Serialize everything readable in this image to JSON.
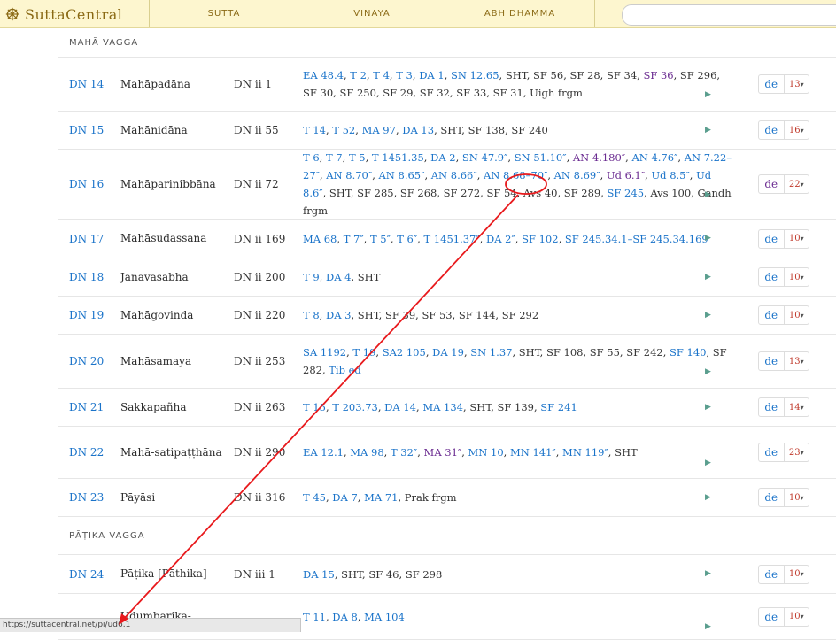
{
  "header": {
    "logo_text": "SuttaCentral",
    "nav": [
      "SUTTA",
      "VINAYA",
      "ABHIDHAMMA"
    ],
    "search_placeholder": ""
  },
  "groups": {
    "g1": "MAHĀ VAGGA",
    "g2": "PĀṬIKA VAGGA"
  },
  "rows": [
    {
      "id": "DN 14",
      "title": "Mahāpadāna",
      "vol": "DN ii 1",
      "parallels": [
        [
          "EA 48.4",
          "link"
        ],
        [
          "T 2",
          "link"
        ],
        [
          "T 4",
          "link"
        ],
        [
          "T 3",
          "link"
        ],
        [
          "DA 1",
          "link"
        ],
        [
          "SN 12.65",
          "link"
        ],
        [
          "SHT",
          ""
        ],
        [
          "SF 56",
          ""
        ],
        [
          "SF 28",
          ""
        ],
        [
          "SF 34",
          ""
        ],
        [
          "SF 36",
          "visited"
        ],
        [
          "SF 296",
          ""
        ],
        [
          "SF 30",
          ""
        ],
        [
          "SF 250",
          ""
        ],
        [
          "SF 29",
          ""
        ],
        [
          "SF 32",
          ""
        ],
        [
          "SF 33",
          ""
        ],
        [
          "SF 31",
          ""
        ],
        [
          "Uigh frgm",
          ""
        ]
      ],
      "lang": "de",
      "count": "13"
    },
    {
      "id": "DN 15",
      "title": "Mahānidāna",
      "vol": "DN ii 55",
      "parallels": [
        [
          "T 14",
          "link"
        ],
        [
          "T 52",
          "link"
        ],
        [
          "MA 97",
          "link"
        ],
        [
          "DA 13",
          "link"
        ],
        [
          "SHT",
          ""
        ],
        [
          "SF 138",
          ""
        ],
        [
          "SF 240",
          ""
        ]
      ],
      "lang": "de",
      "count": "16"
    },
    {
      "id": "DN 16",
      "title": "Mahāparinibbāna",
      "vol": "DN ii 72",
      "parallels": [
        [
          "T 6",
          "link"
        ],
        [
          "T 7",
          "link"
        ],
        [
          "T 5",
          "link"
        ],
        [
          "T 1451.35",
          "link"
        ],
        [
          "DA 2",
          "link"
        ],
        [
          "SN 47.9″",
          "link"
        ],
        [
          "SN 51.10″",
          "link"
        ],
        [
          "AN 4.180″",
          "visited"
        ],
        [
          "AN 4.76″",
          "link"
        ],
        [
          "AN 7.22–27″",
          "link"
        ],
        [
          "AN 8.70″",
          "link"
        ],
        [
          "AN 8.65″",
          "link"
        ],
        [
          "AN 8.66″",
          "link"
        ],
        [
          "AN 8.68–70″",
          "link"
        ],
        [
          "AN 8.69″",
          "link"
        ],
        [
          "Ud 6.1″",
          "visited"
        ],
        [
          "Ud 8.5″",
          "link"
        ],
        [
          "Ud 8.6″",
          "link"
        ],
        [
          "SHT",
          ""
        ],
        [
          "SF 285",
          ""
        ],
        [
          "SF 268",
          ""
        ],
        [
          "SF 272",
          ""
        ],
        [
          "SF 54",
          ""
        ],
        [
          "Avs 40",
          ""
        ],
        [
          "SF 289",
          ""
        ],
        [
          "SF 245",
          "link"
        ],
        [
          "Avs 100",
          ""
        ],
        [
          "Gandh frgm",
          ""
        ]
      ],
      "lang": "de",
      "count": "22"
    },
    {
      "id": "DN 17",
      "title": "Mahāsudassana",
      "vol": "DN ii 169",
      "parallels": [
        [
          "MA 68",
          "link"
        ],
        [
          "T 7″",
          "link"
        ],
        [
          "T 5″",
          "link"
        ],
        [
          "T 6″",
          "link"
        ],
        [
          "T 1451.37″",
          "link"
        ],
        [
          "DA 2″",
          "link"
        ],
        [
          "SF 102",
          "link"
        ],
        [
          "SF 245.34.1–SF 245.34.169",
          "link"
        ]
      ],
      "lang": "de",
      "count": "10"
    },
    {
      "id": "DN 18",
      "title": "Janavasabha",
      "vol": "DN ii 200",
      "parallels": [
        [
          "T 9",
          "link"
        ],
        [
          "DA 4",
          "link"
        ],
        [
          "SHT",
          ""
        ]
      ],
      "lang": "de",
      "count": "10"
    },
    {
      "id": "DN 19",
      "title": "Mahāgovinda",
      "vol": "DN ii 220",
      "parallels": [
        [
          "T 8",
          "link"
        ],
        [
          "DA 3",
          "link"
        ],
        [
          "SHT",
          ""
        ],
        [
          "SF 39",
          ""
        ],
        [
          "SF 53",
          ""
        ],
        [
          "SF 144",
          ""
        ],
        [
          "SF 292",
          ""
        ]
      ],
      "lang": "de",
      "count": "10"
    },
    {
      "id": "DN 20",
      "title": "Mahāsamaya",
      "vol": "DN ii 253",
      "parallels": [
        [
          "SA 1192",
          "link"
        ],
        [
          "T 19",
          "link"
        ],
        [
          "SA2 105",
          "link"
        ],
        [
          "DA 19",
          "link"
        ],
        [
          "SN 1.37",
          "link"
        ],
        [
          "SHT",
          ""
        ],
        [
          "SF 108",
          ""
        ],
        [
          "SF 55",
          ""
        ],
        [
          "SF 242",
          ""
        ],
        [
          "SF 140",
          "link"
        ],
        [
          "SF 282",
          ""
        ],
        [
          "Tib ed",
          "link"
        ]
      ],
      "lang": "de",
      "count": "13"
    },
    {
      "id": "DN 21",
      "title": "Sakkapañha",
      "vol": "DN ii 263",
      "parallels": [
        [
          "T 15",
          "link"
        ],
        [
          "T 203.73",
          "link"
        ],
        [
          "DA 14",
          "link"
        ],
        [
          "MA 134",
          "link"
        ],
        [
          "SHT",
          ""
        ],
        [
          "SF 139",
          ""
        ],
        [
          "SF 241",
          "link"
        ]
      ],
      "lang": "de",
      "count": "14"
    },
    {
      "id": "DN 22",
      "title": "Mahā-satipaṭṭhāna",
      "vol": "DN ii 290",
      "parallels": [
        [
          "EA 12.1",
          "link"
        ],
        [
          "MA 98",
          "link"
        ],
        [
          "T 32″",
          "link"
        ],
        [
          "MA 31″",
          "visited"
        ],
        [
          "MN 10",
          "link"
        ],
        [
          "MN 141″",
          "link"
        ],
        [
          "MN 119″",
          "link"
        ],
        [
          "SHT",
          ""
        ]
      ],
      "lang": "de",
      "count": "23"
    },
    {
      "id": "DN 23",
      "title": "Pāyāsi",
      "vol": "DN ii 316",
      "parallels": [
        [
          "T 45",
          "link"
        ],
        [
          "DA 7",
          "link"
        ],
        [
          "MA 71",
          "link"
        ],
        [
          "Prak frgm",
          ""
        ]
      ],
      "lang": "de",
      "count": "10"
    },
    {
      "id": "DN 24",
      "title": "Pāṭika [Pāthika]",
      "vol": "DN iii 1",
      "parallels": [
        [
          "DA 15",
          "link"
        ],
        [
          "SHT",
          ""
        ],
        [
          "SF 46",
          ""
        ],
        [
          "SF 298",
          ""
        ]
      ],
      "lang": "de",
      "count": "10"
    },
    {
      "id": "",
      "title": "Udumbarika-",
      "vol": "",
      "parallels": [
        [
          "T 11",
          "link"
        ],
        [
          "DA 8",
          "link"
        ],
        [
          "MA 104",
          "link"
        ]
      ],
      "lang": "de",
      "count": "10"
    }
  ],
  "status_url": "https://suttacentral.net/pi/ud6.1",
  "colors": {
    "annotation": "#e8191c",
    "link": "#1a73c9",
    "visited": "#6b2c91"
  }
}
